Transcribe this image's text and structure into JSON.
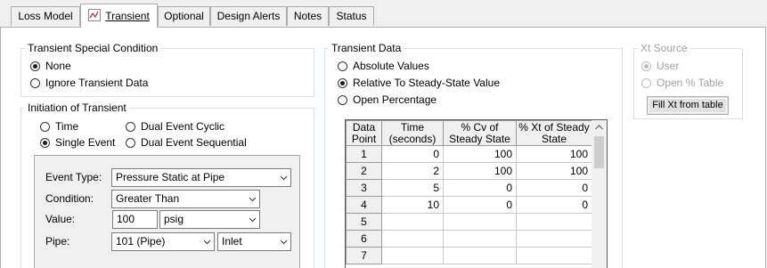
{
  "tabs": [
    {
      "label": "Loss Model"
    },
    {
      "label": "Transient"
    },
    {
      "label": "Optional"
    },
    {
      "label": "Design Alerts"
    },
    {
      "label": "Notes"
    },
    {
      "label": "Status"
    }
  ],
  "special_condition": {
    "title": "Transient Special Condition",
    "options": [
      {
        "label": "None",
        "selected": true
      },
      {
        "label": "Ignore Transient Data",
        "selected": false
      }
    ]
  },
  "initiation": {
    "title": "Initiation of Transient",
    "options": [
      {
        "label": "Time",
        "selected": false
      },
      {
        "label": "Dual Event Cyclic",
        "selected": false
      },
      {
        "label": "Single Event",
        "selected": true
      },
      {
        "label": "Dual Event Sequential",
        "selected": false
      }
    ],
    "event_type_label": "Event Type:",
    "event_type_value": "Pressure Static at Pipe",
    "condition_label": "Condition:",
    "condition_value": "Greater Than",
    "value_label": "Value:",
    "value_value": "100",
    "value_unit": "psig",
    "pipe_label": "Pipe:",
    "pipe_value": "101 (Pipe)",
    "pipe_location": "Inlet"
  },
  "transient_data": {
    "title": "Transient Data",
    "options": [
      {
        "label": "Absolute Values",
        "selected": false
      },
      {
        "label": "Relative To Steady-State Value",
        "selected": true
      },
      {
        "label": "Open Percentage",
        "selected": false
      }
    ],
    "table": {
      "headers": [
        "Data Point",
        "Time (seconds)",
        "% Cv of Steady State",
        "% Xt of Steady State"
      ],
      "rows": [
        [
          "1",
          "0",
          "100",
          "100"
        ],
        [
          "2",
          "2",
          "100",
          "100"
        ],
        [
          "3",
          "5",
          "0",
          "0"
        ],
        [
          "4",
          "10",
          "0",
          "0"
        ],
        [
          "5",
          "",
          "",
          ""
        ],
        [
          "6",
          "",
          "",
          ""
        ],
        [
          "7",
          "",
          "",
          ""
        ]
      ]
    }
  },
  "xt_source": {
    "title": "Xt Source",
    "options": [
      {
        "label": "User",
        "selected": true
      },
      {
        "label": "Open % Table",
        "selected": false
      }
    ],
    "button_label": "Fill Xt from table"
  }
}
